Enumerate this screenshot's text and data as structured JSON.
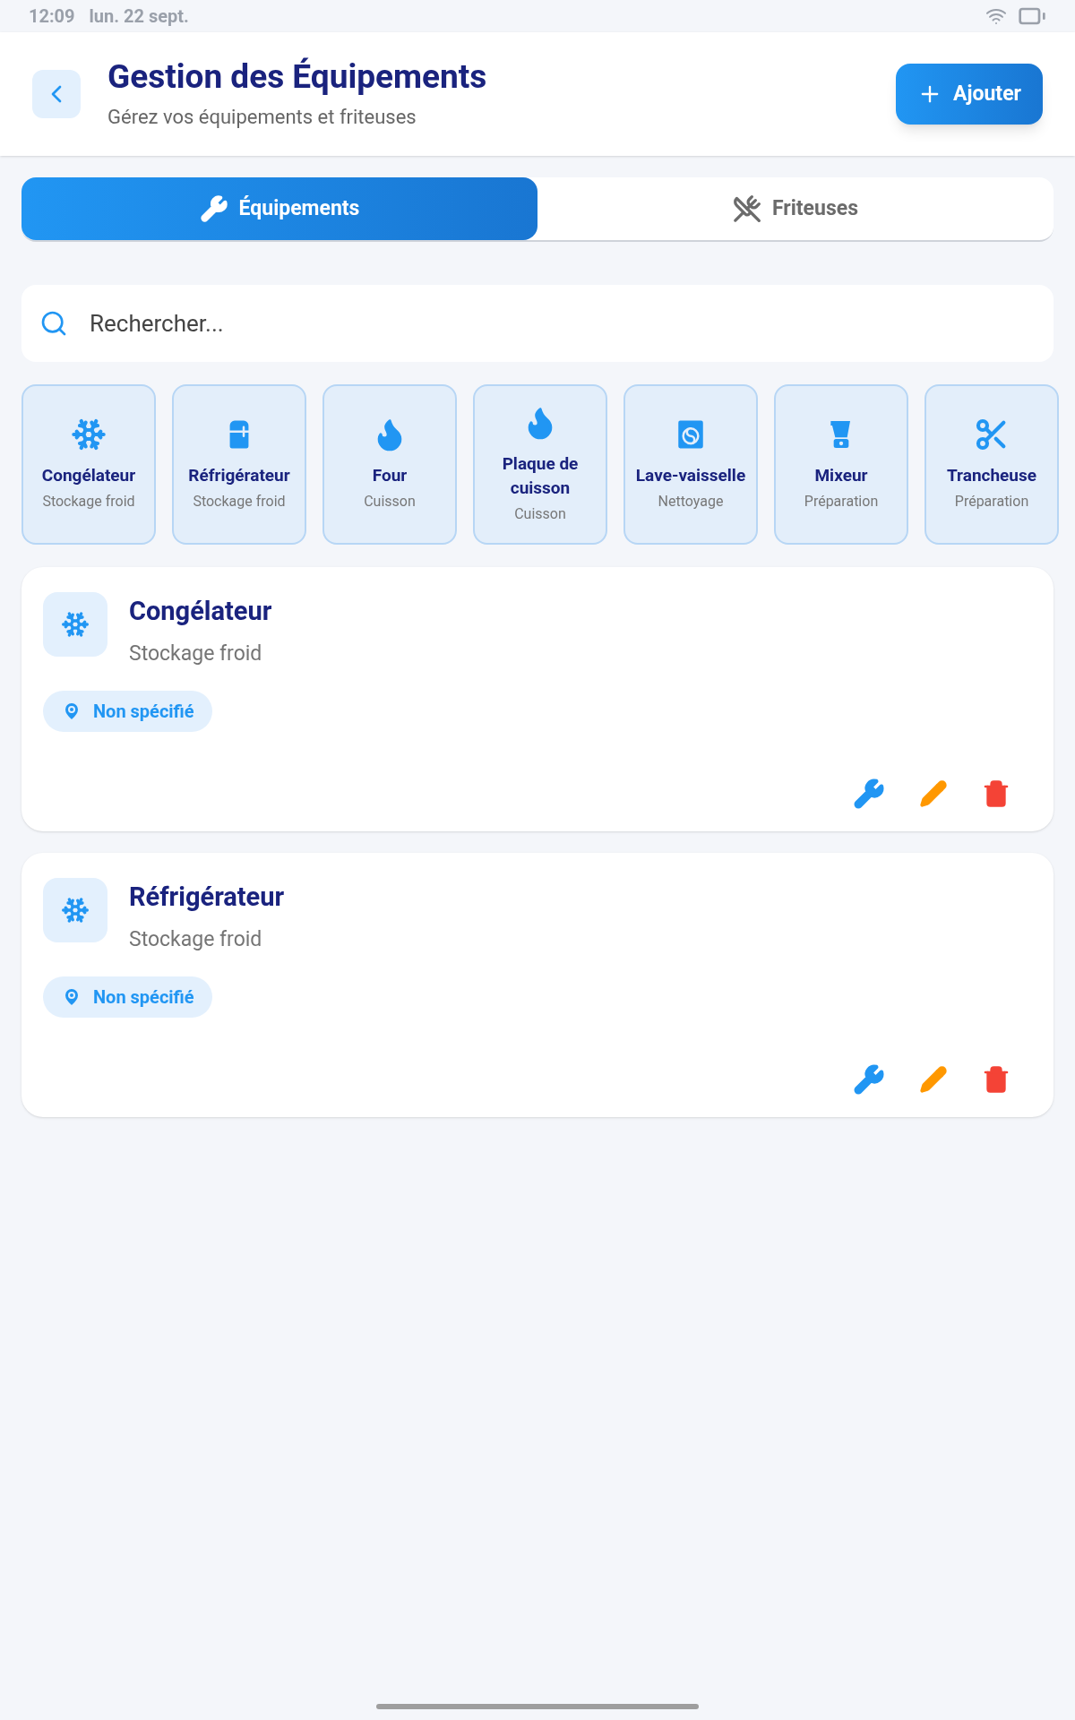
{
  "status_bar": {
    "time": "12:09",
    "date": "lun. 22 sept."
  },
  "header": {
    "title": "Gestion des Équipements",
    "subtitle": "Gérez vos équipements et friteuses",
    "add_button": "Ajouter"
  },
  "tabs": [
    {
      "label": "Équipements",
      "kind": "equipment",
      "selected": true
    },
    {
      "label": "Friteuses",
      "kind": "fryer",
      "selected": false
    }
  ],
  "search": {
    "placeholder": "Rechercher..."
  },
  "categories": [
    {
      "name": "Congélateur",
      "group": "Stockage froid",
      "kind": "freezer"
    },
    {
      "name": "Réfrigérateur",
      "group": "Stockage froid",
      "kind": "fridge"
    },
    {
      "name": "Four",
      "group": "Cuisson",
      "kind": "oven"
    },
    {
      "name": "Plaque de cuisson",
      "group": "Cuisson",
      "kind": "stove"
    },
    {
      "name": "Lave-vaisselle",
      "group": "Nettoyage",
      "kind": "dishwasher"
    },
    {
      "name": "Mixeur",
      "group": "Préparation",
      "kind": "mixer"
    },
    {
      "name": "Trancheuse",
      "group": "Préparation",
      "kind": "slicer"
    }
  ],
  "equipment": [
    {
      "name": "Congélateur",
      "group": "Stockage froid",
      "location": "Non spécifié"
    },
    {
      "name": "Réfrigérateur",
      "group": "Stockage froid",
      "location": "Non spécifié"
    }
  ]
}
